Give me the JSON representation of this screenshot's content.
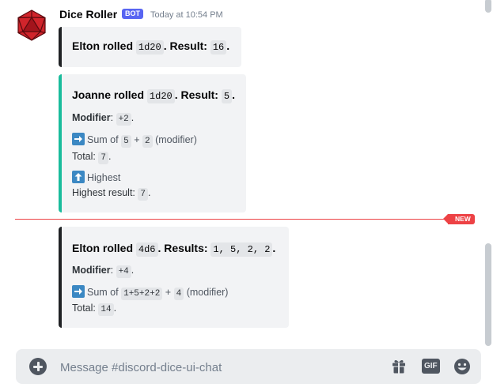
{
  "message": {
    "author": "Dice Roller",
    "badge": "BOT",
    "timestamp": "Today at 10:54 PM"
  },
  "embeds": [
    {
      "color": "#202225",
      "title_prefix": "Elton rolled ",
      "dice": "1d20",
      "title_mid": ". Result: ",
      "result": "16",
      "title_suffix": "."
    },
    {
      "color": "#1abc9c",
      "title_prefix": "Joanne rolled ",
      "dice": "1d20",
      "title_mid": ". Result: ",
      "result": "5",
      "title_suffix": ".",
      "modifier_label": "Modifier",
      "modifier_value": "+2",
      "sum_label": "Sum of",
      "sum_a": "5",
      "sum_op": "+",
      "sum_b": "2",
      "sum_note": "(modifier)",
      "total_label": "Total:",
      "total_value": "7",
      "highest_label": "Highest",
      "highest_result_label": "Highest result:",
      "highest_result_value": "7"
    },
    {
      "color": "#202225",
      "title_prefix": "Elton rolled ",
      "dice": "4d6",
      "title_mid": ". Results: ",
      "result": "1, 5, 2, 2",
      "title_suffix": ".",
      "modifier_label": "Modifier",
      "modifier_value": "+4",
      "sum_label": "Sum of",
      "sum_a": "1+5+2+2",
      "sum_op": "+",
      "sum_b": "4",
      "sum_note": "(modifier)",
      "total_label": "Total:",
      "total_value": "14"
    }
  ],
  "divider": {
    "label": "NEW",
    "color": "#ed4245"
  },
  "composer": {
    "placeholder": "Message #discord-dice-ui-chat",
    "gif_label": "GIF",
    "icons": [
      "plus-icon",
      "gift-icon",
      "gif-icon",
      "emoji-icon"
    ]
  },
  "colors": {
    "accent": "#5865f2",
    "teal": "#1abc9c",
    "new": "#ed4245"
  }
}
